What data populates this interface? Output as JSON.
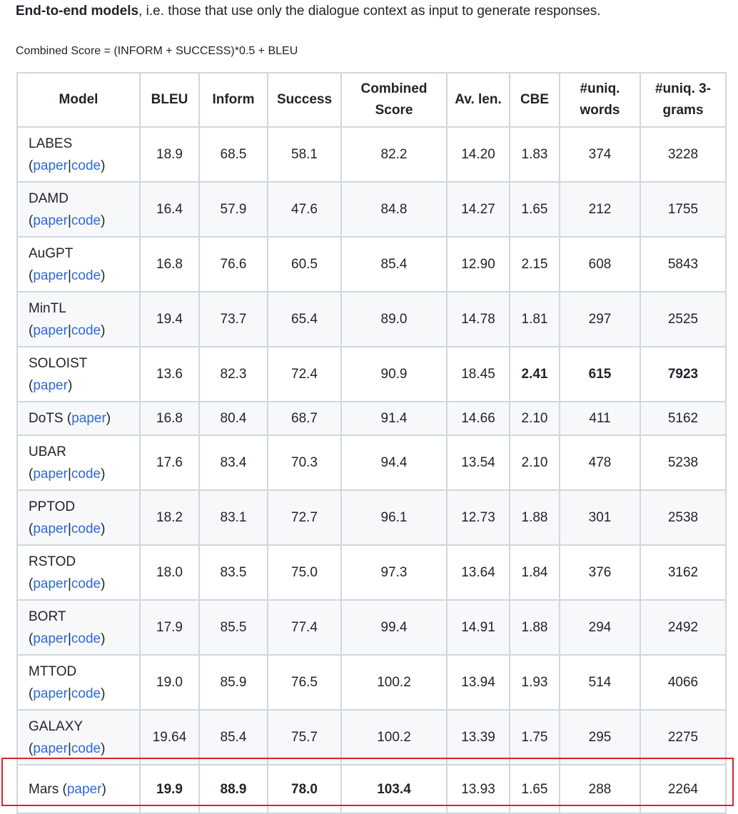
{
  "intro": {
    "bold": "End-to-end models",
    "rest": ", i.e. those that use only the dialogue context as input to generate responses."
  },
  "formula": "Combined Score = (INFORM + SUCCESS)*0.5 + BLEU",
  "headers": [
    "Model",
    "BLEU",
    "Inform",
    "Success",
    "Combined Score",
    "Av. len.",
    "CBE",
    "#uniq. words",
    "#uniq. 3-grams"
  ],
  "link_labels": {
    "paper": "paper",
    "code": "code"
  },
  "rows": [
    {
      "model": "LABES",
      "links": [
        "paper",
        "code"
      ],
      "values": [
        "18.9",
        "68.5",
        "58.1",
        "82.2",
        "14.20",
        "1.83",
        "374",
        "3228"
      ],
      "bold": []
    },
    {
      "model": "DAMD",
      "links": [
        "paper",
        "code"
      ],
      "values": [
        "16.4",
        "57.9",
        "47.6",
        "84.8",
        "14.27",
        "1.65",
        "212",
        "1755"
      ],
      "bold": []
    },
    {
      "model": "AuGPT",
      "links": [
        "paper",
        "code"
      ],
      "values": [
        "16.8",
        "76.6",
        "60.5",
        "85.4",
        "12.90",
        "2.15",
        "608",
        "5843"
      ],
      "bold": []
    },
    {
      "model": "MinTL",
      "links": [
        "paper",
        "code"
      ],
      "values": [
        "19.4",
        "73.7",
        "65.4",
        "89.0",
        "14.78",
        "1.81",
        "297",
        "2525"
      ],
      "bold": []
    },
    {
      "model": "SOLOIST",
      "links": [
        "paper"
      ],
      "values": [
        "13.6",
        "82.3",
        "72.4",
        "90.9",
        "18.45",
        "2.41",
        "615",
        "7923"
      ],
      "bold": [
        5,
        6,
        7
      ]
    },
    {
      "model": "DoTS",
      "links": [
        "paper"
      ],
      "inline": true,
      "values": [
        "16.8",
        "80.4",
        "68.7",
        "91.4",
        "14.66",
        "2.10",
        "411",
        "5162"
      ],
      "bold": []
    },
    {
      "model": "UBAR",
      "links": [
        "paper",
        "code"
      ],
      "values": [
        "17.6",
        "83.4",
        "70.3",
        "94.4",
        "13.54",
        "2.10",
        "478",
        "5238"
      ],
      "bold": []
    },
    {
      "model": "PPTOD",
      "links": [
        "paper",
        "code"
      ],
      "values": [
        "18.2",
        "83.1",
        "72.7",
        "96.1",
        "12.73",
        "1.88",
        "301",
        "2538"
      ],
      "bold": []
    },
    {
      "model": "RSTOD",
      "links": [
        "paper",
        "code"
      ],
      "values": [
        "18.0",
        "83.5",
        "75.0",
        "97.3",
        "13.64",
        "1.84",
        "376",
        "3162"
      ],
      "bold": []
    },
    {
      "model": "BORT",
      "links": [
        "paper",
        "code"
      ],
      "values": [
        "17.9",
        "85.5",
        "77.4",
        "99.4",
        "14.91",
        "1.88",
        "294",
        "2492"
      ],
      "bold": []
    },
    {
      "model": "MTTOD",
      "links": [
        "paper",
        "code"
      ],
      "values": [
        "19.0",
        "85.9",
        "76.5",
        "100.2",
        "13.94",
        "1.93",
        "514",
        "4066"
      ],
      "bold": []
    },
    {
      "model": "GALAXY",
      "links": [
        "paper",
        "code"
      ],
      "values": [
        "19.64",
        "85.4",
        "75.7",
        "100.2",
        "13.39",
        "1.75",
        "295",
        "2275"
      ],
      "bold": []
    },
    {
      "model": "Mars",
      "links": [
        "paper"
      ],
      "inline": true,
      "values": [
        "19.9",
        "88.9",
        "78.0",
        "103.4",
        "13.93",
        "1.65",
        "288",
        "2264"
      ],
      "bold": [
        0,
        1,
        2,
        3
      ],
      "highlighted": true
    }
  ]
}
